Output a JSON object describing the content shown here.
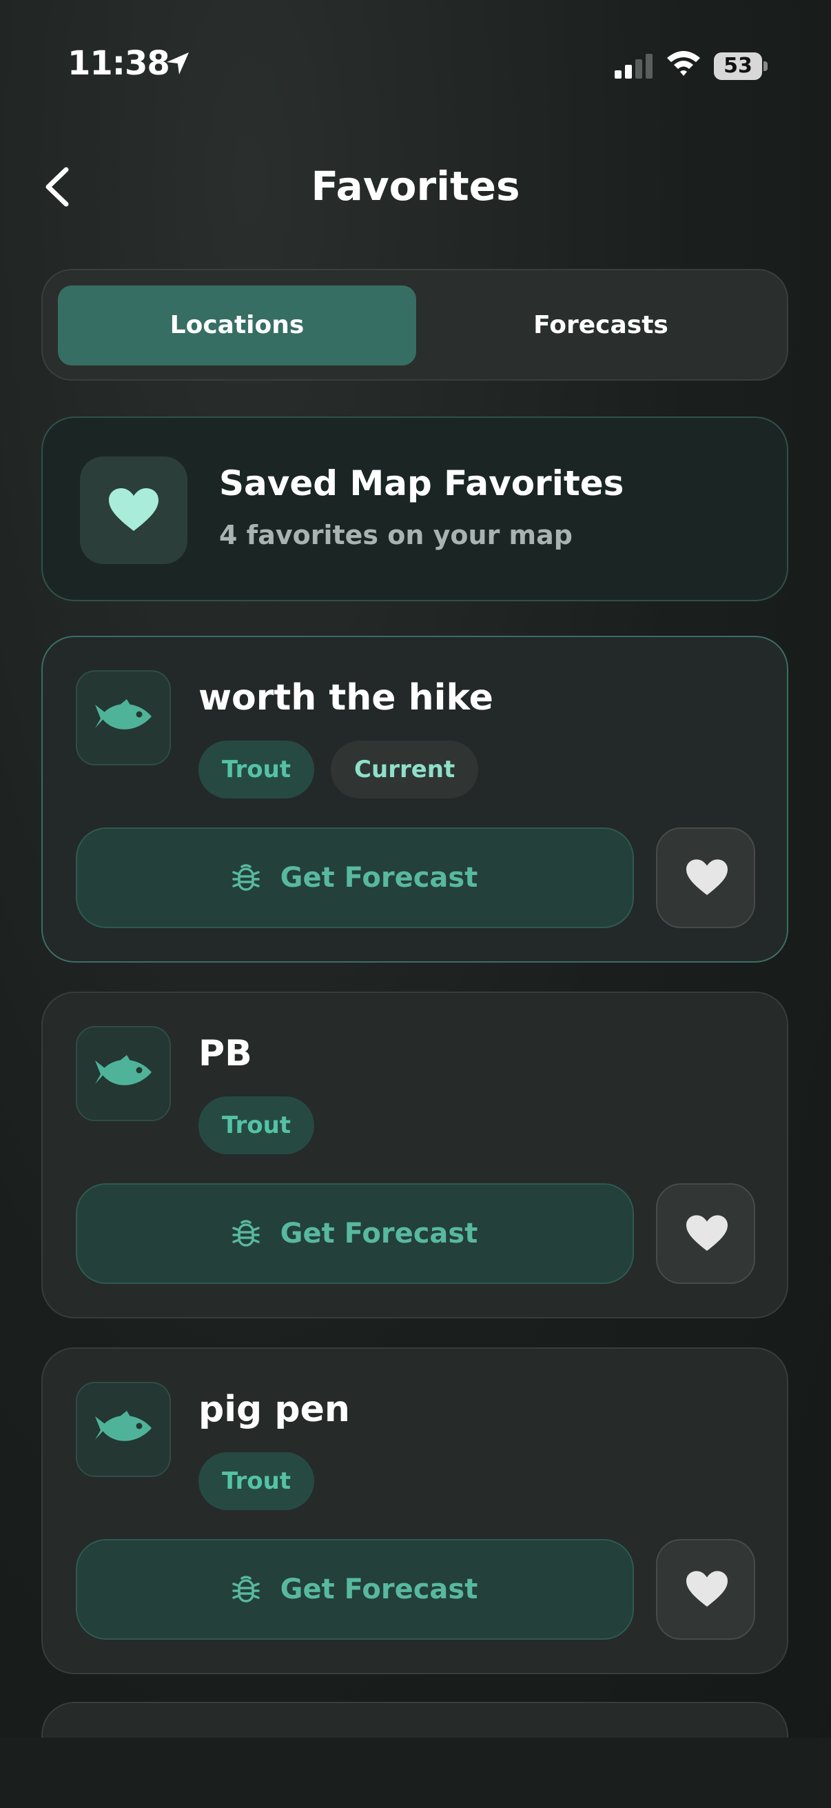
{
  "status_bar": {
    "time": "11:38",
    "battery": "53"
  },
  "nav": {
    "title": "Favorites"
  },
  "tabs": [
    {
      "label": "Locations",
      "active": true
    },
    {
      "label": "Forecasts",
      "active": false
    }
  ],
  "summary": {
    "title": "Saved Map Favorites",
    "subtitle": "4 favorites on your map"
  },
  "cards": [
    {
      "name": "worth the hike",
      "tags": [
        "Trout",
        "Current"
      ],
      "button": "Get Forecast"
    },
    {
      "name": "PB",
      "tags": [
        "Trout"
      ],
      "button": "Get Forecast"
    },
    {
      "name": "pig pen",
      "tags": [
        "Trout"
      ],
      "button": "Get Forecast"
    }
  ],
  "colors": {
    "accent": "#366e63",
    "tag_text": "#54c2a6",
    "background": "#1a1e1c"
  }
}
